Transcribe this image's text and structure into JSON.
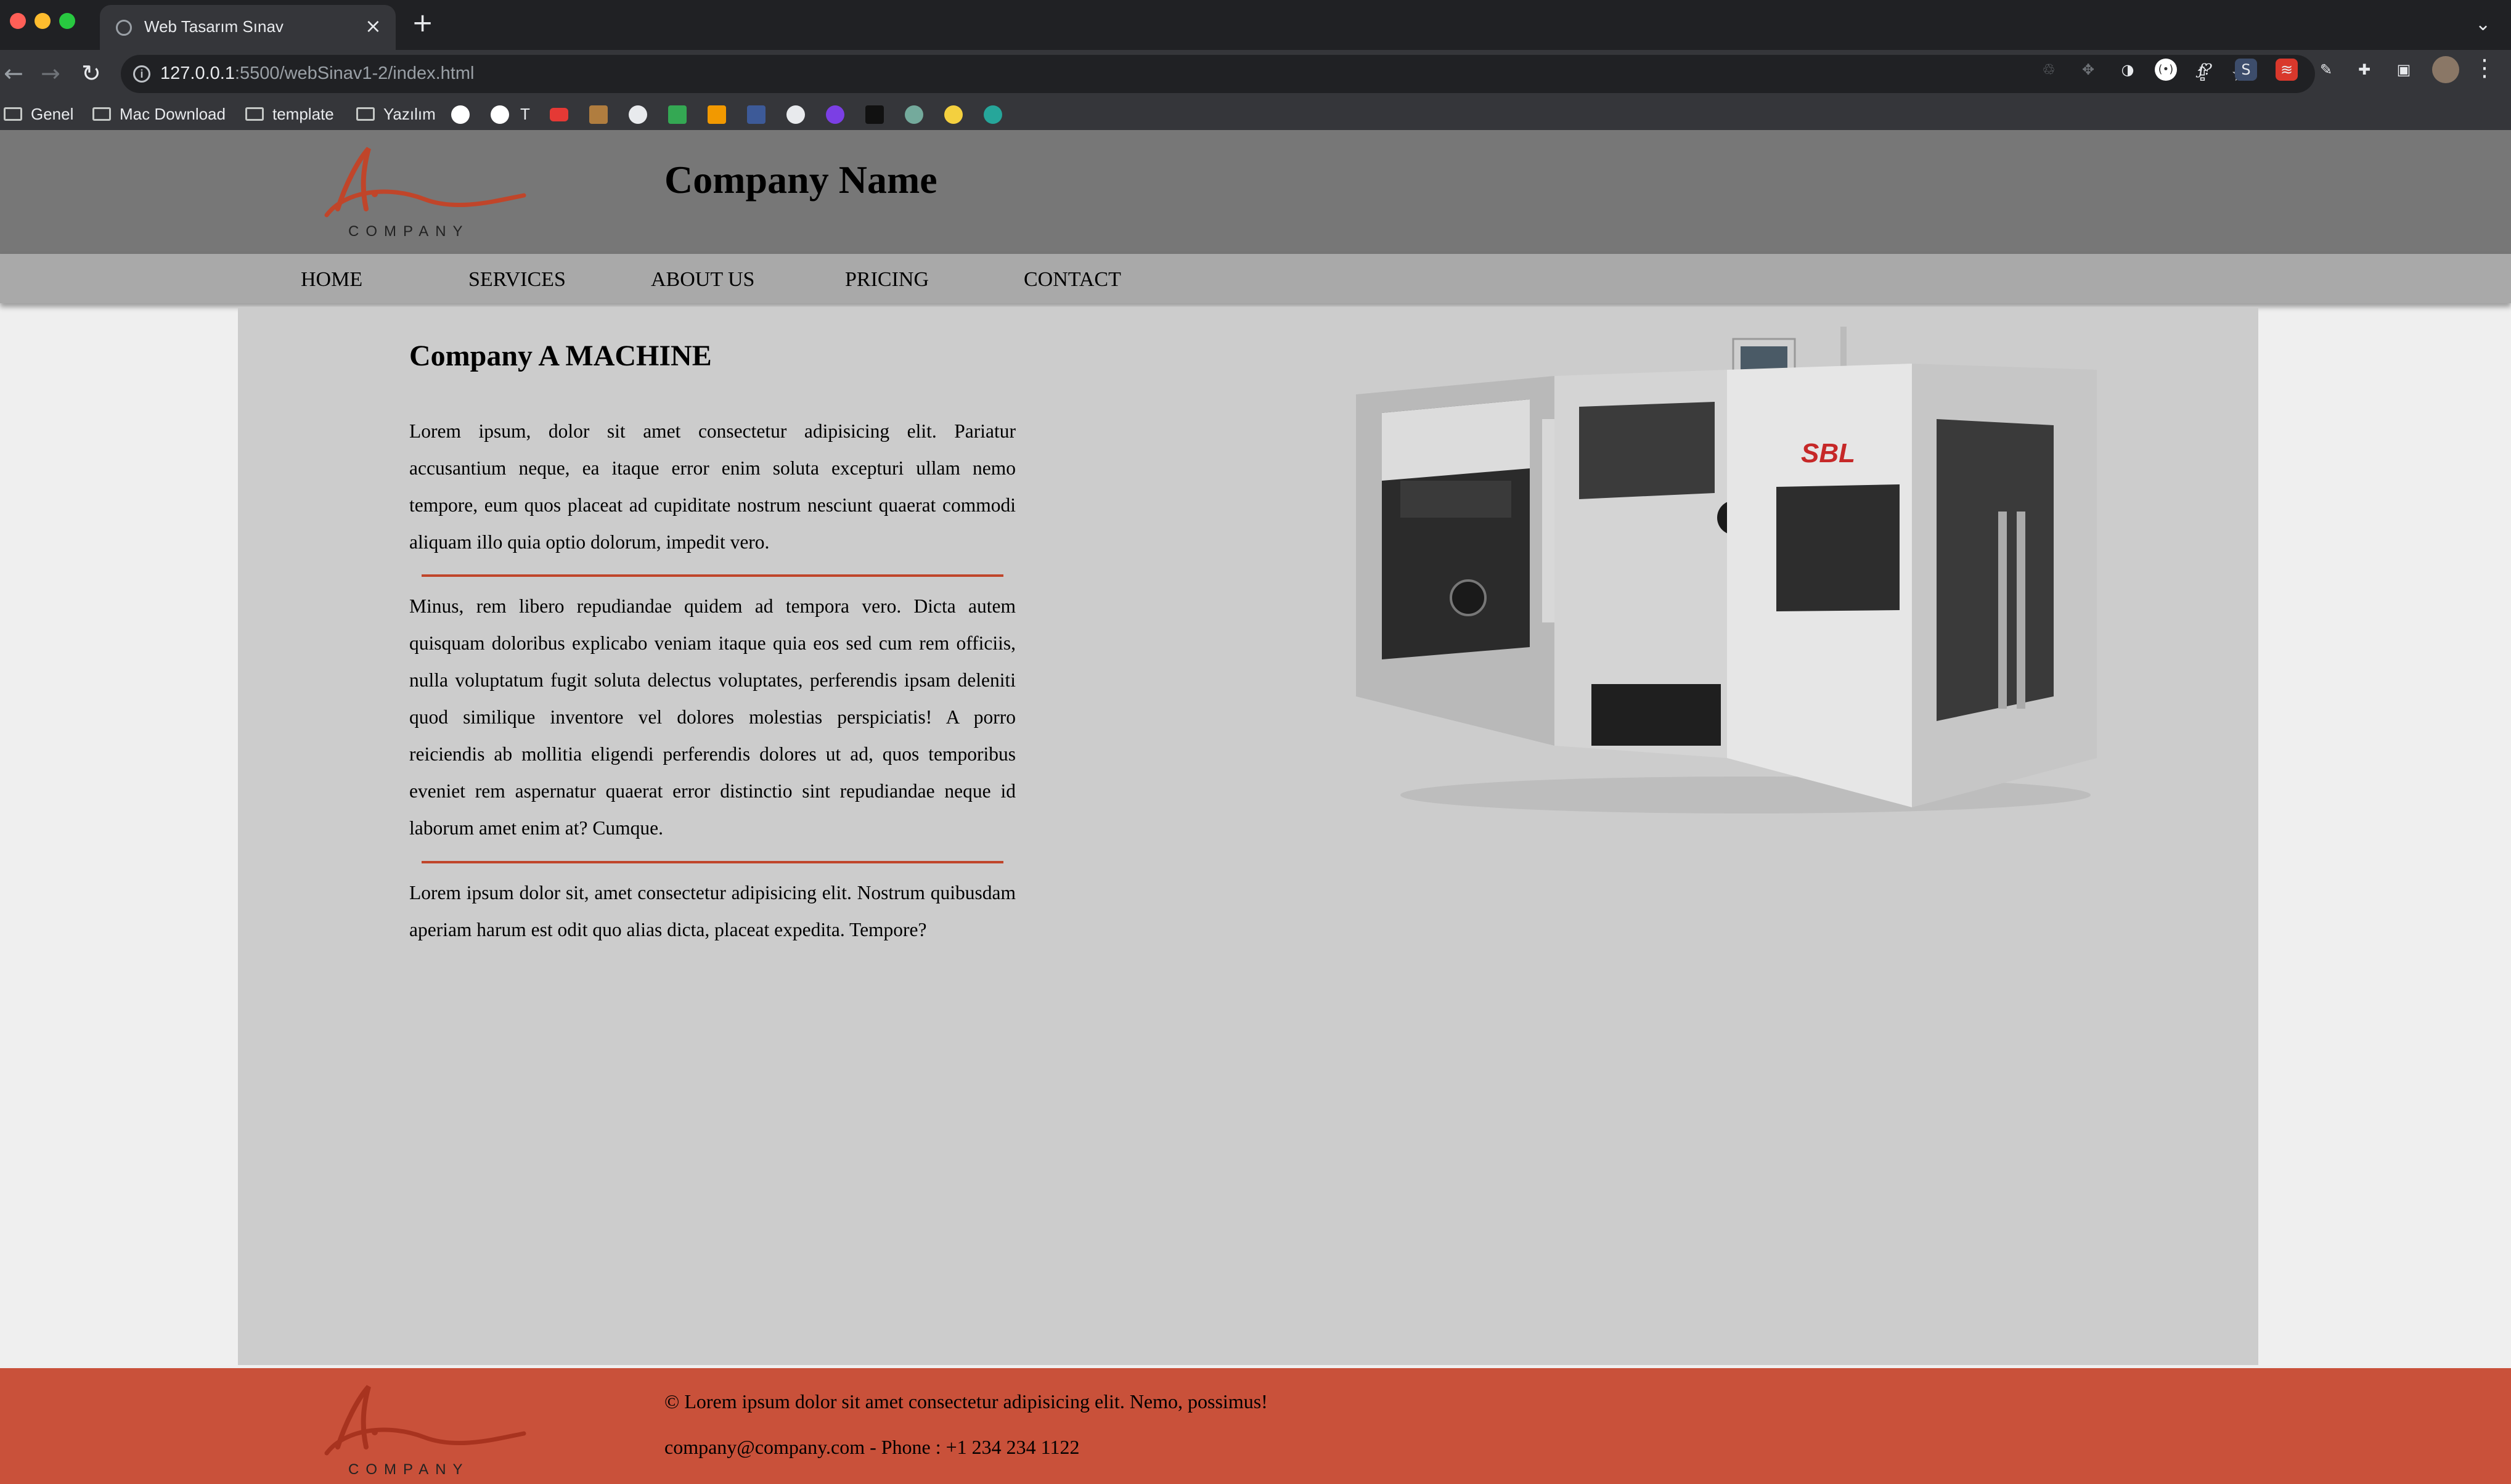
{
  "browser": {
    "tab_title": "Web Tasarım Sınav",
    "url_host": "127.0.0.1",
    "url_path": ":5500/webSinav1-2/index.html",
    "bookmarks": [
      {
        "label": "Genel",
        "icon": "folder-icon"
      },
      {
        "label": "Mac Download",
        "icon": "folder-icon"
      },
      {
        "label": "template",
        "icon": "folder-icon"
      },
      {
        "label": "Yazılım",
        "icon": "folder-icon"
      },
      {
        "label": "T",
        "icon": "google-icon"
      }
    ],
    "extension_icons": [
      "google-icon",
      "google-icon",
      "youtube-icon",
      "mountain-icon",
      "github-icon",
      "chart-icon",
      "orange-square-icon",
      "s-icon",
      "compass-icon",
      "u-icon",
      "medium-icon",
      "chatgpt-icon",
      "cloud-icon",
      "globe-icon"
    ],
    "colors": {
      "tab_bar": "#202124",
      "toolbar": "#35363a"
    }
  },
  "header": {
    "company_name": "Company Name",
    "logo_text": "COMPANY"
  },
  "nav": {
    "items": [
      "HOME",
      "SERVICES",
      "ABOUT US",
      "PRICING",
      "CONTACT"
    ]
  },
  "main": {
    "heading": "Company A MACHINE",
    "paragraphs": [
      "Lorem ipsum, dolor sit amet consectetur adipisicing elit. Pariatur accusantium neque, ea itaque error enim soluta excepturi ullam nemo tempore, eum quos placeat ad cupiditate nostrum nesciunt quaerat commodi aliquam illo quia optio dolorum, impedit vero.",
      "Minus, rem libero repudiandae quidem ad tempora vero. Dicta autem quisquam doloribus explicabo veniam itaque quia eos sed cum rem officiis, nulla voluptatum fugit soluta delectus voluptates, perferendis ipsam deleniti quod similique inventore vel dolores molestias perspiciatis! A porro reiciendis ab mollitia eligendi perferendis dolores ut ad, quos temporibus eveniet rem aspernatur quaerat error distinctio sint repudiandae neque id laborum amet enim at? Cumque.",
      "Lorem ipsum dolor sit, amet consectetur adipisicing elit. Nostrum quibusdam aperiam harum est odit quo alias dicta, placeat expedita. Tempore?"
    ],
    "machine_brand": "SBL"
  },
  "footer": {
    "copyright": "© Lorem ipsum dolor sit amet consectetur adipisicing elit. Nemo, possimus!",
    "contact": "company@company.com - Phone : +1 234 234 1122",
    "logo_text": "COMPANY"
  },
  "colors": {
    "header": "#777777",
    "navbar": "#a9a9a9",
    "content": "#cccccc",
    "accent": "#c0452a",
    "footer": "#c9513a"
  }
}
